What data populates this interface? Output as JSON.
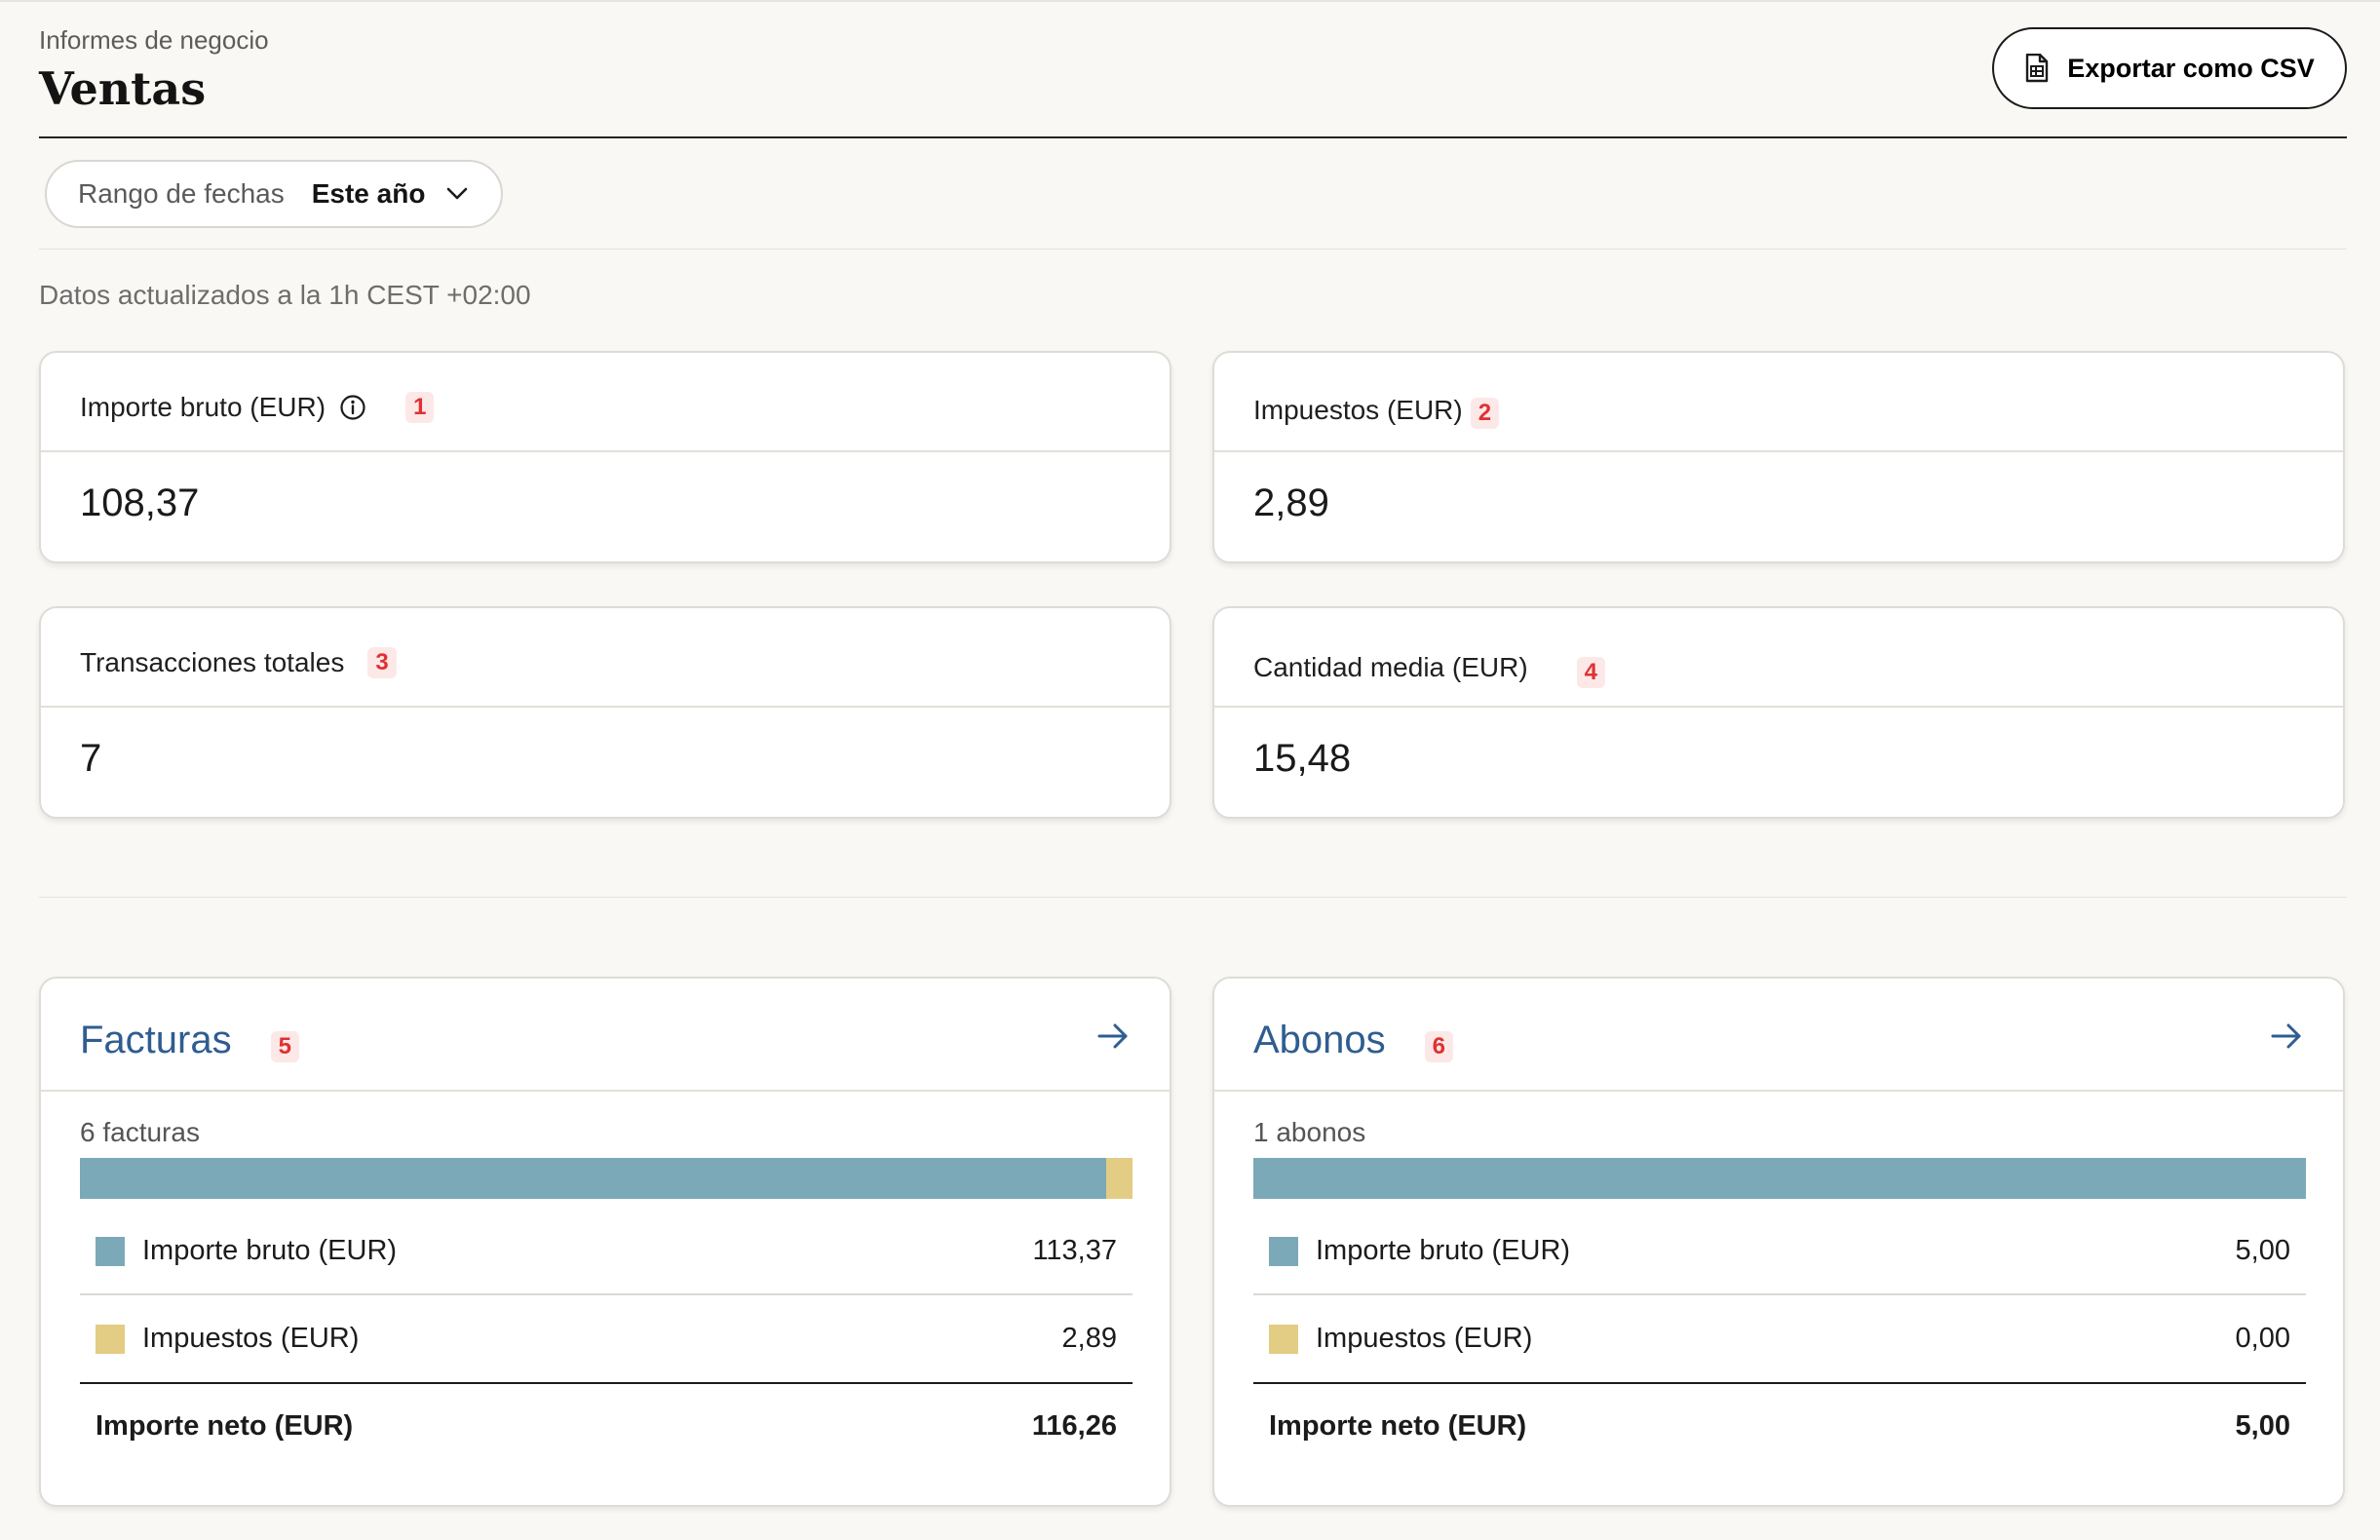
{
  "header": {
    "eyebrow": "Informes de negocio",
    "title": "Ventas",
    "export_label": "Exportar como CSV"
  },
  "filter": {
    "label": "Rango de fechas",
    "value": "Este año"
  },
  "updated_text": "Datos actualizados a la 1h CEST +02:00",
  "metrics": [
    {
      "label": "Importe bruto (EUR)",
      "badge": "1",
      "value": "108,37"
    },
    {
      "label": "Impuestos (EUR)",
      "badge": "2",
      "value": "2,89"
    },
    {
      "label": "Transacciones totales",
      "badge": "3",
      "value": "7"
    },
    {
      "label": "Cantidad media (EUR)",
      "badge": "4",
      "value": "15,48"
    }
  ],
  "panels": [
    {
      "title": "Facturas",
      "badge": "5",
      "count": "6 facturas",
      "gross_fraction": 0.975,
      "rows": [
        {
          "label": "Importe bruto (EUR)",
          "value": "113,37"
        },
        {
          "label": "Impuestos (EUR)",
          "value": "2,89"
        },
        {
          "label": "Importe neto (EUR)",
          "value": "116,26"
        }
      ]
    },
    {
      "title": "Abonos",
      "badge": "6",
      "count": "1 abonos",
      "gross_fraction": 1.0,
      "rows": [
        {
          "label": "Importe bruto (EUR)",
          "value": "5,00"
        },
        {
          "label": "Impuestos (EUR)",
          "value": "0,00"
        },
        {
          "label": "Importe neto (EUR)",
          "value": "5,00"
        }
      ]
    }
  ],
  "colors": {
    "gross": "#7ca9b8",
    "tax": "#e3cc84",
    "panel_title": "#2f5d90",
    "badge": "#e03131"
  }
}
